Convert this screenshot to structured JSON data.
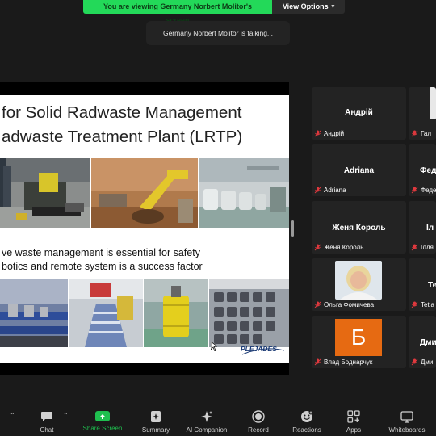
{
  "banner": {
    "viewing_text": "You are viewing Germany Norbert Molitor's screen",
    "view_options": "View Options"
  },
  "toast": {
    "talking": "Germany Norbert Molitor is talking..."
  },
  "slide": {
    "title_line1": "for Solid Radwaste Management",
    "title_line2": "adwaste Treatment Plant (LRTP)",
    "text_line1": "ve waste management is essential for safety",
    "text_line2": "botics and remote system is a success factor",
    "logo": "PLEJADES"
  },
  "participants": [
    {
      "tile_name": "Андрій",
      "label": "Андрій"
    },
    {
      "tile_name": "",
      "label": "Гал"
    },
    {
      "tile_name": "Adriana",
      "label": "Adriana"
    },
    {
      "tile_name": "Фед",
      "label": "Феде"
    },
    {
      "tile_name": "Женя Король",
      "label": "Женя Король"
    },
    {
      "tile_name": "Іл",
      "label": "Ілля"
    },
    {
      "tile_name": "",
      "label": "Ольга Фомичева"
    },
    {
      "tile_name": "Те",
      "label": "Tetia"
    },
    {
      "tile_name": "",
      "label": "Влад Боднарчук",
      "avatar_letter": "Б"
    },
    {
      "tile_name": "Дми",
      "label": "Дми"
    }
  ],
  "toolbar": {
    "chat": "Chat",
    "share_screen": "Share Screen",
    "summary": "Summary",
    "ai_companion": "AI Companion",
    "record": "Record",
    "reactions": "Reactions",
    "apps": "Apps",
    "whiteboards": "Whiteboards"
  },
  "colors": {
    "banner_green": "#23d959",
    "share_green": "#1fbf4f",
    "avatar_orange": "#e66a12",
    "mic_red": "#e0393e"
  }
}
